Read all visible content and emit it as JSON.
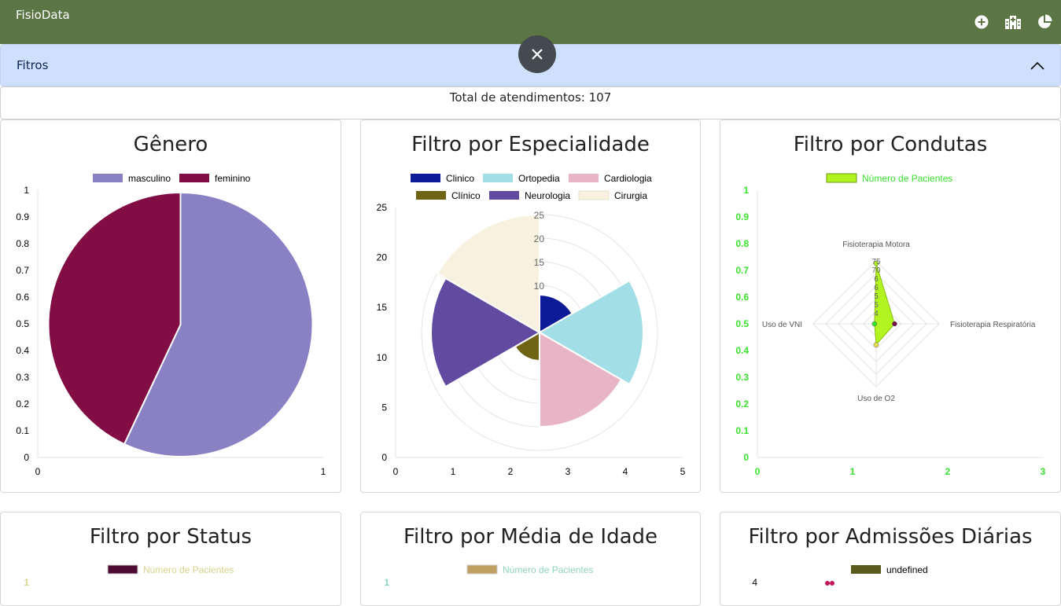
{
  "app": {
    "title": "FisioData"
  },
  "nav": {
    "icons": [
      "plus-circle-icon",
      "hospital-icon",
      "pie-chart-icon"
    ]
  },
  "filters": {
    "label": "Fitros"
  },
  "summary": {
    "total_label": "Total de atendimentos: 107"
  },
  "colors": {
    "topbar": "#5b7644",
    "filters_bg": "#cfe0fd",
    "close_button": "#444a50"
  },
  "chart_data": [
    {
      "type": "pie",
      "title": "Gênero",
      "labels": [
        "masculino",
        "feminino"
      ],
      "values": [
        57,
        43
      ],
      "colors": [
        "#8a80c4",
        "#820d44"
      ],
      "y_ticks": [
        "1",
        "0.9",
        "0.8",
        "0.7",
        "0.6",
        "0.5",
        "0.4",
        "0.3",
        "0.2",
        "0.1",
        "0"
      ],
      "x_ticks": [
        "0",
        "1"
      ]
    },
    {
      "type": "polarArea",
      "title": "Filtro por Especialidade",
      "labels": [
        "Clinico",
        "Ortopedia",
        "Cardiologia",
        "Clínico",
        "Neurologia",
        "Cirurgia"
      ],
      "values": [
        8,
        22,
        20,
        6,
        23,
        25
      ],
      "colors": [
        "#0c1c99",
        "#a2dee5",
        "#e7b5c5",
        "#6e6413",
        "#614aa0",
        "#f8f1df"
      ],
      "radial_max": 25,
      "radial_ticks": [
        "25",
        "20",
        "15",
        "10"
      ],
      "y_ticks": [
        "25",
        "20",
        "15",
        "10",
        "5",
        "0"
      ],
      "x_ticks": [
        "0",
        "1",
        "2",
        "3",
        "4",
        "5"
      ]
    },
    {
      "type": "radar",
      "title": "Filtro por Condutas",
      "series": [
        {
          "name": "Número de Pacientes",
          "values": [
            72,
            22,
            25,
            2
          ]
        }
      ],
      "axes": [
        "Fisioterapia Motora",
        "Fisioterapia Respiratória",
        "Uso de O2",
        "Uso de VNI"
      ],
      "radial_max": 75,
      "radial_ticks": [
        "75",
        "70",
        "6",
        "6",
        "5",
        "5",
        "4"
      ],
      "y_ticks": [
        "1",
        "0.9",
        "0.8",
        "0.7",
        "0.6",
        "0.5",
        "0.4",
        "0.3",
        "0.2",
        "0.1",
        "0"
      ],
      "x_ticks": [
        "0",
        "1",
        "2",
        "3"
      ],
      "colors": {
        "fill": "#b1f422",
        "legend_text": "#39e22d"
      }
    },
    {
      "type": "bar",
      "title": "Filtro por Status",
      "series": [
        {
          "name": "Número de Pacientes",
          "values": []
        }
      ],
      "y_ticks": [
        "1"
      ],
      "colors": {
        "legend_box": "#4d0a32",
        "legend_text": "#d8d28a",
        "tick": "#d8d28a"
      }
    },
    {
      "type": "bar",
      "title": "Filtro por Média de Idade",
      "series": [
        {
          "name": "Número de Pacientes",
          "values": []
        }
      ],
      "y_ticks": [
        "1"
      ],
      "colors": {
        "legend_box": "#bfa062",
        "legend_text": "#8ed4b8",
        "tick": "#8ed4b8"
      }
    },
    {
      "type": "line",
      "title": "Filtro por Admissões Diárias",
      "series": [
        {
          "name": "undefined",
          "values": []
        }
      ],
      "y_ticks": [
        "4"
      ],
      "colors": {
        "legend_box": "#5a5a1a",
        "legend_text": "#000000",
        "point": "#c2185b"
      }
    }
  ]
}
